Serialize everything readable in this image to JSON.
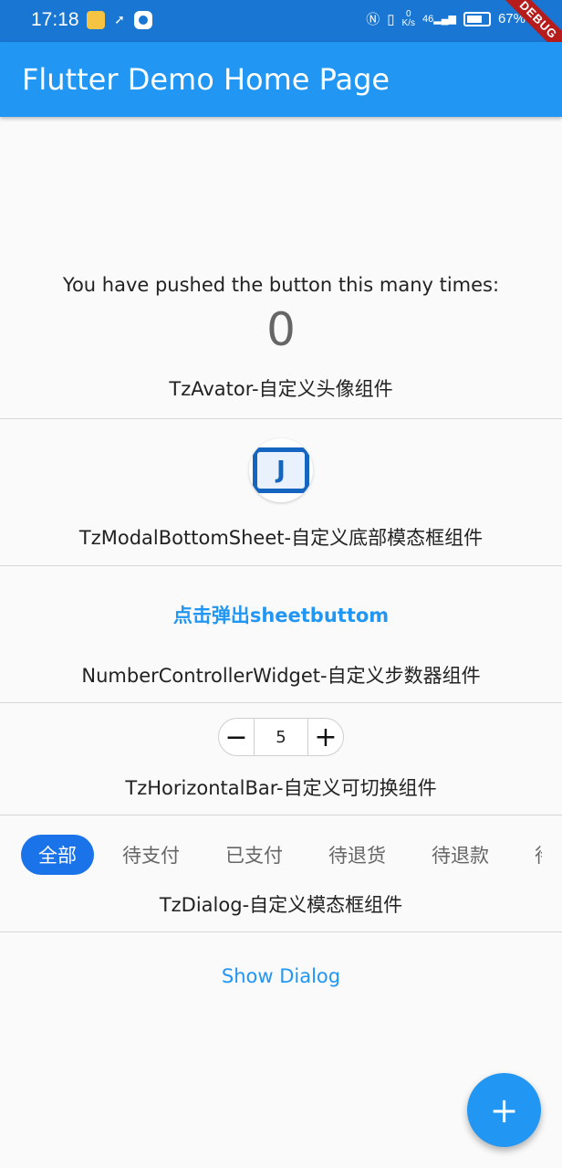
{
  "status_bar": {
    "time": "17:18",
    "net_speed_value": "0",
    "net_speed_unit": "K/s",
    "signal": "46",
    "battery": "67%",
    "icons": [
      "car-icon",
      "plane-icon",
      "app-icon",
      "nfc-icon",
      "vibrate-icon",
      "signal-icon",
      "battery-icon"
    ]
  },
  "debug_banner": "DEBUG",
  "app_bar": {
    "title": "Flutter Demo Home Page"
  },
  "counter": {
    "label": "You have pushed the button this many times:",
    "value": "0"
  },
  "sections": {
    "avatar_title": "TzAvator-自定义头像组件",
    "modal_title": "TzModalBottomSheet-自定义底部模态框组件",
    "sheet_button": "点击弹出sheetbuttom",
    "number_title": "NumberControllerWidget-自定义步数器组件",
    "horizontal_title": "TzHorizontalBar-自定义可切换组件",
    "dialog_title": "TzDialog-自定义模态框组件",
    "dialog_button": "Show Dialog"
  },
  "stepper": {
    "minus": "−",
    "value": "5",
    "plus": "+"
  },
  "tabs": [
    {
      "label": "全部",
      "active": true
    },
    {
      "label": "待支付",
      "active": false
    },
    {
      "label": "已支付",
      "active": false
    },
    {
      "label": "待退货",
      "active": false
    },
    {
      "label": "待退款",
      "active": false
    },
    {
      "label": "待",
      "active": false
    }
  ],
  "avatar": {
    "glyph": "J"
  },
  "fab": {
    "icon": "plus-icon",
    "symbol": "+"
  },
  "colors": {
    "primary": "#2196f3",
    "status_bar": "#1976d2",
    "tab_active": "#1a73e8"
  }
}
